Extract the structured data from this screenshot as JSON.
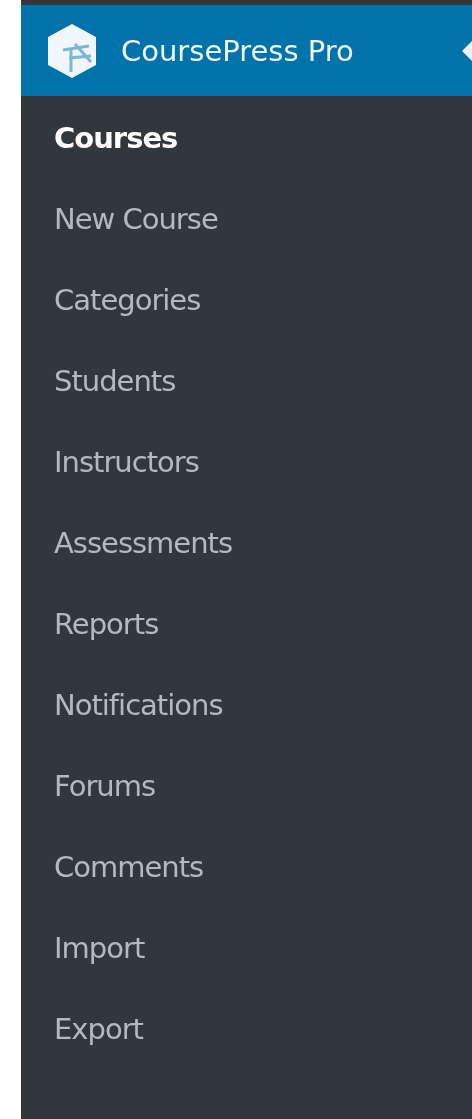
{
  "header": {
    "title": "CoursePress Pro"
  },
  "menu": [
    {
      "label": "Courses",
      "selected": true
    },
    {
      "label": "New Course",
      "selected": false
    },
    {
      "label": "Categories",
      "selected": false
    },
    {
      "label": "Students",
      "selected": false
    },
    {
      "label": "Instructors",
      "selected": false
    },
    {
      "label": "Assessments",
      "selected": false
    },
    {
      "label": "Reports",
      "selected": false
    },
    {
      "label": "Notifications",
      "selected": false
    },
    {
      "label": "Forums",
      "selected": false
    },
    {
      "label": "Comments",
      "selected": false
    },
    {
      "label": "Import",
      "selected": false
    },
    {
      "label": "Export",
      "selected": false
    }
  ]
}
